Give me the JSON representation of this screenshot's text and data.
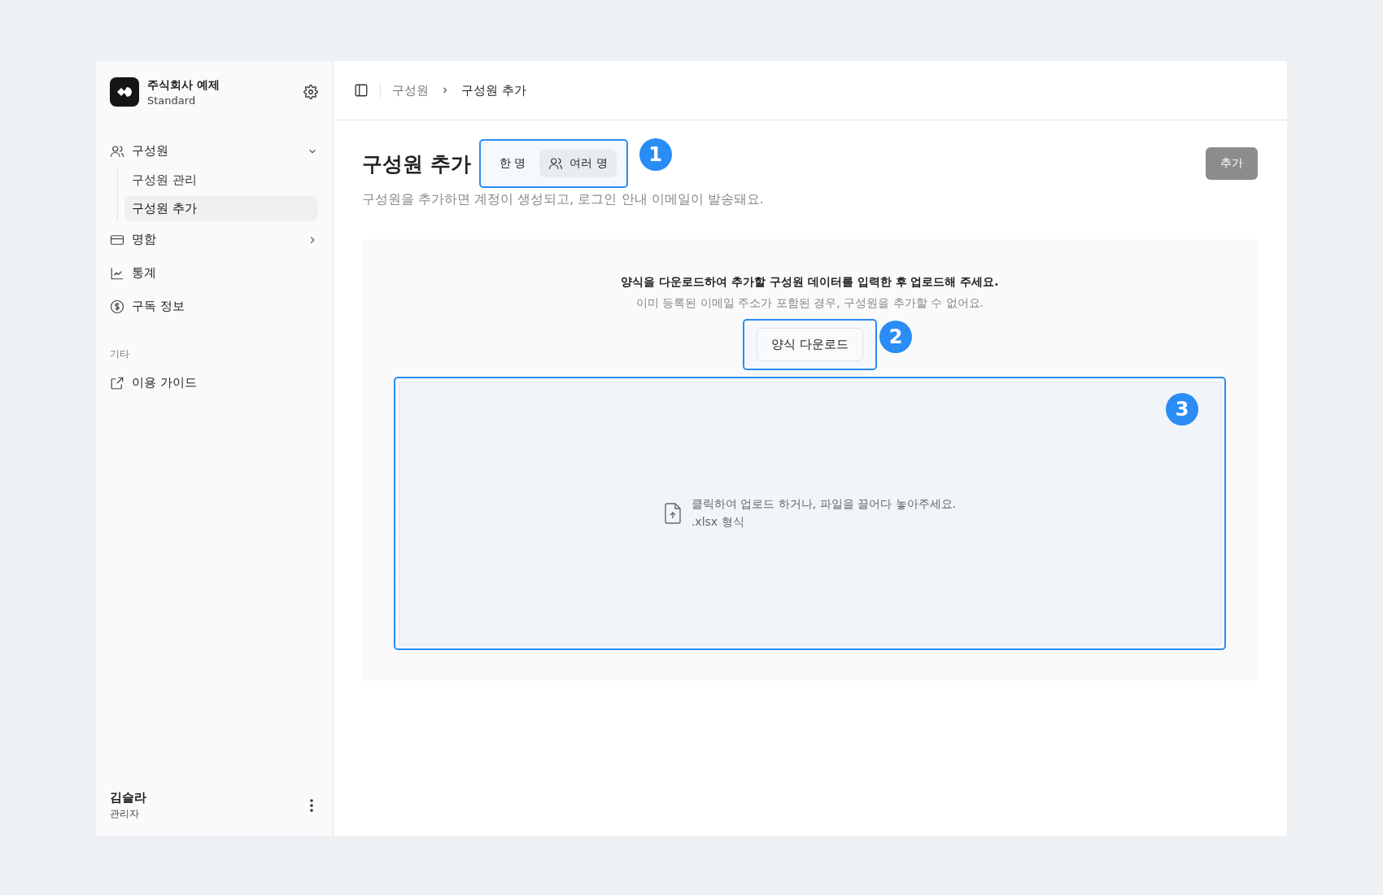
{
  "sidebar": {
    "org": {
      "name": "주식회사 예제",
      "plan": "Standard"
    },
    "nav": [
      {
        "kind": "group",
        "label": "구성원",
        "expanded": true,
        "children": [
          {
            "label": "구성원 관리",
            "selected": false
          },
          {
            "label": "구성원 추가",
            "selected": true
          }
        ]
      },
      {
        "kind": "group",
        "label": "명함",
        "expanded": false
      },
      {
        "kind": "link",
        "label": "통계"
      },
      {
        "kind": "link",
        "label": "구독 정보"
      }
    ],
    "section_label": "기타",
    "other_items": [
      {
        "label": "이용 가이드"
      }
    ],
    "user": {
      "name": "김슬라",
      "role": "관리자"
    }
  },
  "header": {
    "breadcrumb": [
      {
        "label": "구성원",
        "current": false
      },
      {
        "label": "구성원 추가",
        "current": true
      }
    ]
  },
  "page": {
    "title": "구성원 추가",
    "description": "구성원을 추가하면 계정이 생성되고, 로그인 안내 이메일이 발송돼요.",
    "mode_tabs": [
      {
        "label": "한 명",
        "selected": false
      },
      {
        "label": "여러 명",
        "selected": true
      }
    ],
    "mode_callout": "1",
    "add_button": {
      "label": "추가",
      "disabled": true
    },
    "upload": {
      "instruction": "양식을 다운로드하여 추가할 구성원 데이터를 입력한 후 업로드해 주세요.",
      "note": "이미 등록된 이메일 주소가 포함된 경우, 구성원을 추가할 수 없어요.",
      "download_button": "양식 다운로드",
      "download_callout": "2",
      "dropzone": {
        "text": "클릭하여 업로드 하거나, 파일을 끌어다 놓아주세요.",
        "hint": ".xlsx 형식",
        "callout": "3"
      }
    }
  }
}
